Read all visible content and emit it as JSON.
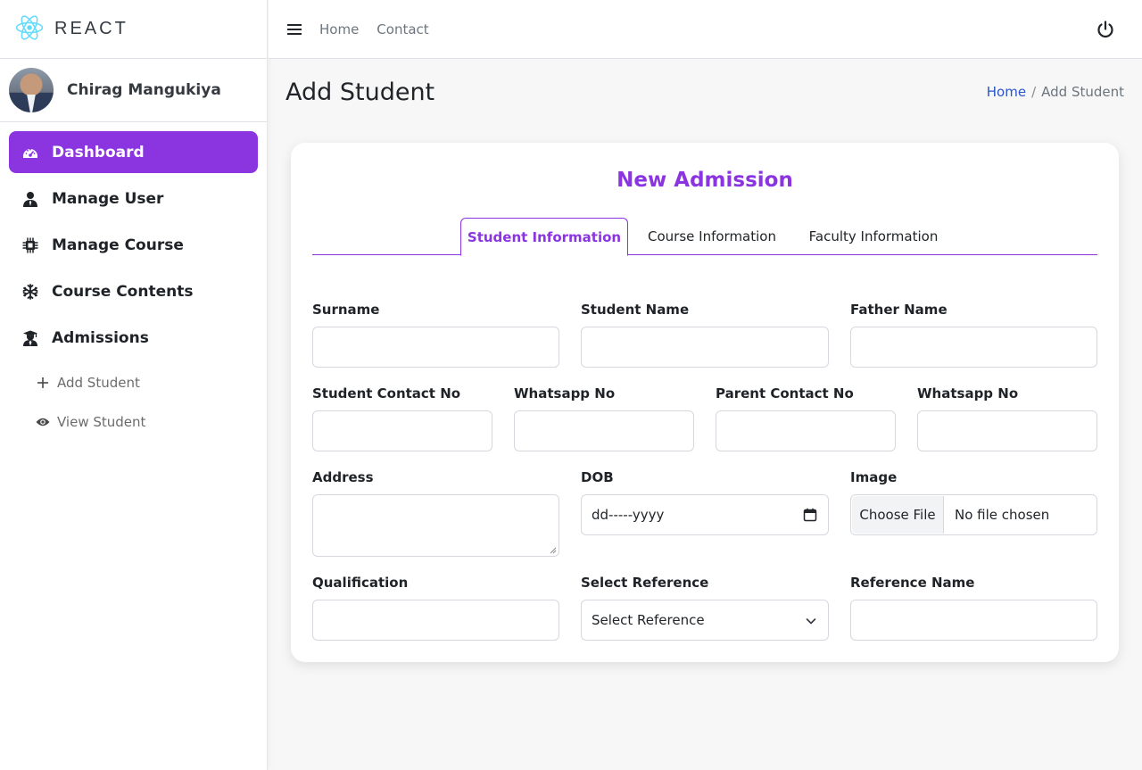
{
  "brand": {
    "name": "REACT",
    "accent": "#61dafb"
  },
  "user": {
    "name": "Chirag Mangukiya"
  },
  "sidebar": {
    "items": [
      {
        "label": "Dashboard",
        "icon": "gauge-icon",
        "active": true
      },
      {
        "label": "Manage User",
        "icon": "user-icon"
      },
      {
        "label": "Manage Course",
        "icon": "chip-icon"
      },
      {
        "label": "Course Contents",
        "icon": "snowflake-icon"
      },
      {
        "label": "Admissions",
        "icon": "graduate-icon"
      }
    ],
    "subitems": [
      {
        "label": "Add Student",
        "icon": "plus-icon"
      },
      {
        "label": "View Student",
        "icon": "eye-icon"
      }
    ]
  },
  "topbar": {
    "links": [
      "Home",
      "Contact"
    ],
    "icons": [
      "hamburger-icon",
      "power-icon"
    ]
  },
  "page": {
    "title": "Add Student"
  },
  "breadcrumb": {
    "home": "Home",
    "separator": "/",
    "current": "Add Student"
  },
  "card": {
    "title": "New Admission",
    "tabs": [
      {
        "label": "Student Information",
        "active": true
      },
      {
        "label": "Course Information"
      },
      {
        "label": "Faculty Information"
      }
    ]
  },
  "form": {
    "surname": {
      "label": "Surname",
      "value": ""
    },
    "student_name": {
      "label": "Student Name",
      "value": ""
    },
    "father_name": {
      "label": "Father Name",
      "value": ""
    },
    "student_contact": {
      "label": "Student Contact No",
      "value": ""
    },
    "student_whatsapp": {
      "label": "Whatsapp No",
      "value": ""
    },
    "parent_contact": {
      "label": "Parent Contact No",
      "value": ""
    },
    "parent_whatsapp": {
      "label": "Whatsapp No",
      "value": ""
    },
    "address": {
      "label": "Address",
      "value": ""
    },
    "dob": {
      "label": "DOB",
      "placeholder": "dd-----yyyy"
    },
    "image": {
      "label": "Image",
      "button": "Choose File",
      "status": "No file chosen"
    },
    "qualification": {
      "label": "Qualification",
      "value": ""
    },
    "reference": {
      "label": "Select Reference",
      "selected": "Select Reference"
    },
    "reference_name": {
      "label": "Reference Name",
      "value": ""
    }
  },
  "colors": {
    "primary": "#8b35e0",
    "link": "#2b55c9",
    "background": "#f7f7f7"
  }
}
